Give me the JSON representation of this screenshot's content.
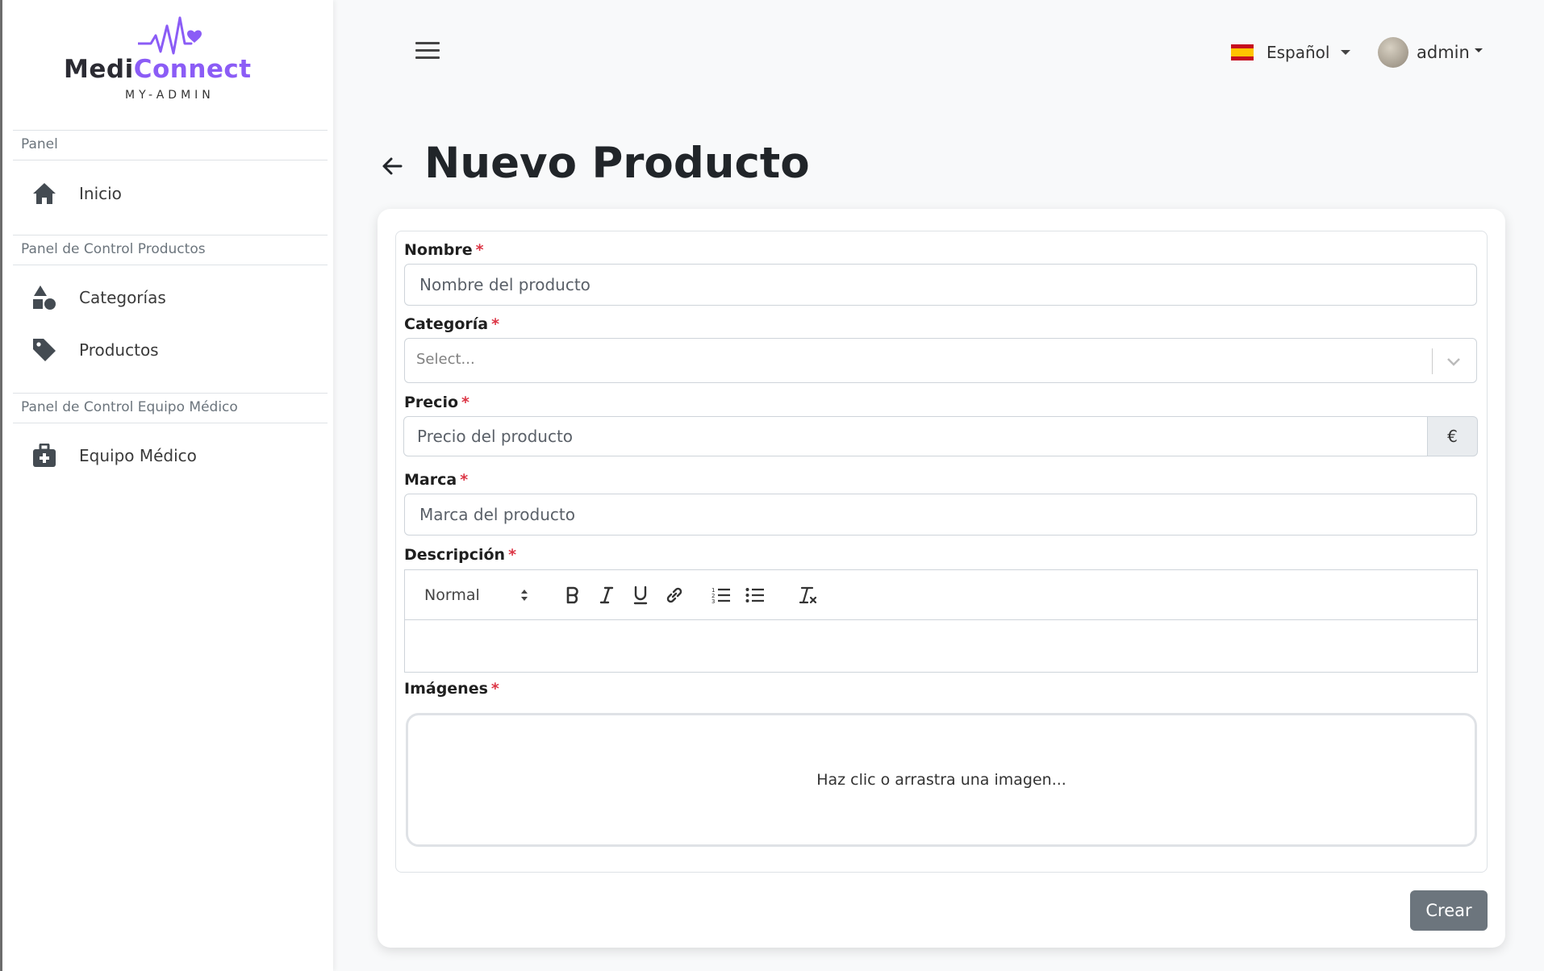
{
  "brand": {
    "name_part1": "Medi",
    "name_part2": "Connect",
    "subtitle": "MY-ADMIN",
    "primary_color": "#8b5cf6"
  },
  "sidebar": {
    "sections": [
      {
        "header": "Panel",
        "items": [
          {
            "label": "Inicio",
            "icon": "home-icon"
          }
        ]
      },
      {
        "header": "Panel de Control Productos",
        "items": [
          {
            "label": "Categorías",
            "icon": "shapes-icon"
          },
          {
            "label": "Productos",
            "icon": "tag-icon"
          }
        ]
      },
      {
        "header": "Panel de Control Equipo Médico",
        "items": [
          {
            "label": "Equipo Médico",
            "icon": "medical-kit-icon"
          }
        ]
      }
    ]
  },
  "topbar": {
    "language": "Español",
    "language_flag": "spain-flag-icon",
    "user": "admin"
  },
  "page": {
    "title": "Nuevo Producto"
  },
  "form": {
    "name": {
      "label": "Nombre",
      "placeholder": "Nombre del producto",
      "value": ""
    },
    "category": {
      "label": "Categoría",
      "placeholder": "Select..."
    },
    "price": {
      "label": "Precio",
      "placeholder": "Precio del producto",
      "value": "",
      "currency": "€"
    },
    "brand": {
      "label": "Marca",
      "placeholder": "Marca del producto",
      "value": ""
    },
    "description": {
      "label": "Descripción",
      "text_format": "Normal",
      "value": ""
    },
    "images": {
      "label": "Imágenes",
      "dropzone_text": "Haz clic o arrastra una imagen..."
    },
    "required_marker": "*",
    "submit_label": "Crear",
    "submit_color": "#6c757d",
    "required_color": "#dc3545"
  }
}
